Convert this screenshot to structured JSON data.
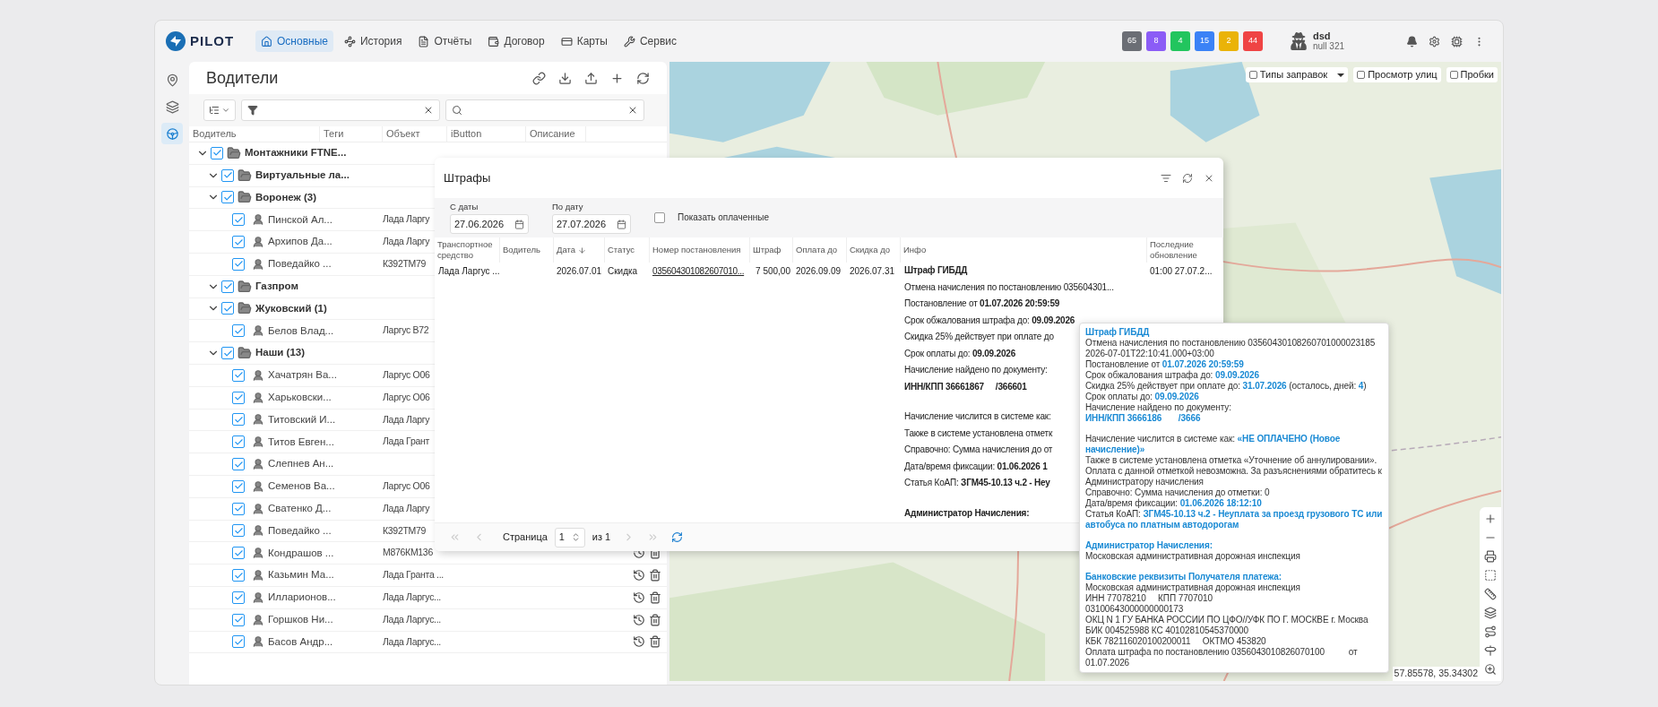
{
  "app": {
    "logo": "PILOT",
    "nav": [
      {
        "label": "Основные",
        "selected": true
      },
      {
        "label": "История",
        "selected": false
      },
      {
        "label": "Отчёты",
        "selected": false
      },
      {
        "label": "Договор",
        "selected": false
      },
      {
        "label": "Карты",
        "selected": false
      },
      {
        "label": "Сервис",
        "selected": false
      }
    ],
    "badges": [
      {
        "text": "65",
        "color": "#6b6e75"
      },
      {
        "text": "8",
        "color": "#8b5cf6"
      },
      {
        "text": "4",
        "color": "#22c55e"
      },
      {
        "text": "15",
        "color": "#3b82f6"
      },
      {
        "text": "2",
        "color": "#eab308"
      },
      {
        "text": "44",
        "color": "#ef4444"
      }
    ],
    "user": {
      "name": "dsd",
      "subtitle": "null 321"
    }
  },
  "sidebar": {
    "items": [
      {
        "selected": false
      },
      {
        "selected": false
      },
      {
        "selected": true
      }
    ]
  },
  "drivers_panel": {
    "title": "Водители",
    "columns": [
      "Водитель",
      "Теги",
      "Объект",
      "iButton",
      "Описание"
    ],
    "tree": [
      {
        "kind": "group",
        "label": "Монтажники FTNE...",
        "expanded": true,
        "checked": true,
        "children": [
          {
            "kind": "group",
            "label": "Виртуальные ла...",
            "expanded": true,
            "checked": true
          },
          {
            "kind": "group",
            "label": "Воронеж (3)",
            "expanded": true,
            "checked": true,
            "children": [
              {
                "kind": "driver",
                "label": "Пинской Ал...",
                "object": "Лада Ларгу",
                "checked": true,
                "actions": false
              },
              {
                "kind": "driver",
                "label": "Архипов Да...",
                "object": "Лада Ларгу",
                "checked": true,
                "actions": false
              },
              {
                "kind": "driver",
                "label": "Поведайко ...",
                "object": "К392ТМ79",
                "checked": true,
                "actions": false
              }
            ]
          },
          {
            "kind": "group",
            "label": "Газпром",
            "expanded": true,
            "checked": true
          },
          {
            "kind": "group",
            "label": "Жуковский (1)",
            "expanded": true,
            "checked": true,
            "children": [
              {
                "kind": "driver",
                "label": "Белов Влад...",
                "object": "Ларгус В72",
                "checked": true,
                "actions": false
              }
            ]
          },
          {
            "kind": "group",
            "label": "Наши (13)",
            "expanded": true,
            "checked": true,
            "children": [
              {
                "kind": "driver",
                "label": "Хачатрян Ва...",
                "object": "Ларгус О06",
                "checked": true,
                "actions": false
              },
              {
                "kind": "driver",
                "label": "Харьковски...",
                "object": "Ларгус О06",
                "checked": true,
                "actions": false
              },
              {
                "kind": "driver",
                "label": "Титовский И...",
                "object": "Лада Ларгу",
                "checked": true,
                "actions": false
              },
              {
                "kind": "driver",
                "label": "Титов Евген...",
                "object": "Лада Грант",
                "checked": true,
                "actions": false
              },
              {
                "kind": "driver",
                "label": "Слепнев Ан...",
                "checked": true,
                "actions": false
              },
              {
                "kind": "driver",
                "label": "Семенов Ва...",
                "object": "Ларгус О06",
                "checked": true,
                "actions": false
              },
              {
                "kind": "driver",
                "label": "Сватенко Д...",
                "object": "Лада Ларгу",
                "checked": true,
                "actions": false
              },
              {
                "kind": "driver",
                "label": "Поведайко ...",
                "object": "К392ТМ79",
                "checked": true,
                "actions": false
              },
              {
                "kind": "driver",
                "label": "Кондрашов ...",
                "object": "М876КМ136",
                "checked": true,
                "actions": true
              },
              {
                "kind": "driver",
                "label": "Казьмин Ма...",
                "object": "Лада Гранта ...",
                "checked": true,
                "actions": true
              },
              {
                "kind": "driver",
                "label": "Илларионов...",
                "object": "Лада Ларгус...",
                "checked": true,
                "actions": true
              },
              {
                "kind": "driver",
                "label": "Горшков Ни...",
                "object": "Лада Ларгус...",
                "checked": true,
                "actions": true
              },
              {
                "kind": "driver",
                "label": "Басов Андр...",
                "object": "Лада Ларгус...",
                "checked": true,
                "actions": true
              }
            ]
          }
        ]
      }
    ]
  },
  "map": {
    "toggles": [
      {
        "label": "Типы заправок",
        "checked": false,
        "dropdown": true
      },
      {
        "label": "Просмотр улиц",
        "checked": false,
        "dropdown": false
      },
      {
        "label": "Пробки",
        "checked": false,
        "dropdown": false
      }
    ],
    "coordinates": "57.85578, 35.34302"
  },
  "fines_dialog": {
    "title": "Штрафы",
    "from": {
      "label": "С даты",
      "value": "27.06.2026"
    },
    "to": {
      "label": "По дату",
      "value": "27.07.2026"
    },
    "show_paid": {
      "label": "Показать оплаченные",
      "checked": false
    },
    "columns": [
      "Транспортное средство",
      "Водитель",
      "Дата",
      "Статус",
      "Номер постановления",
      "Штраф",
      "Оплата до",
      "Скидка до",
      "Инфо",
      "Последние обновление"
    ],
    "rows": [
      {
        "vehicle": "Лада Ларгус ...",
        "date": "2026.07.01",
        "status": "Скидка",
        "number": "035604301082607010...",
        "fine": "7 500,00",
        "pay_until": "2026.09.09",
        "discount_until": "2026.07.31",
        "updated": "01:00 27.07.2...",
        "info": [
          {
            "text": "Штраф ГИБДД",
            "kind": "bold",
            "gap": false
          },
          {
            "text": "Отмена начисления по постановлению 035604301...",
            "kind": "text",
            "gap": false
          },
          {
            "text": "Постановление от **01.07.2026 20:59:59**",
            "kind": "text",
            "gap": false
          },
          {
            "text": "Срок обжалования штрафа до: **09.09.2026**",
            "kind": "text",
            "gap": false
          },
          {
            "text": "Скидка 25% действует при оплате до",
            "kind": "text",
            "gap": false
          },
          {
            "text": "Срок оплаты до: **09.09.2026**",
            "kind": "text",
            "gap": false
          },
          {
            "text": "Начисление найдено по документу:",
            "kind": "text",
            "gap": false
          },
          {
            "text": "ИНН/КПП 36661867     /366601",
            "kind": "bold",
            "gap": false
          },
          {
            "text": "Начисление числится в системе как:",
            "kind": "text",
            "gap": true
          },
          {
            "text": "Также в системе установлена отметк",
            "kind": "text",
            "gap": false
          },
          {
            "text": "Справочно: Сумма начисления до от",
            "kind": "text",
            "gap": false
          },
          {
            "text": "Дата/время фиксации: **01.06.2026 1**",
            "kind": "text",
            "gap": false
          },
          {
            "text": "Статья КоАП: **ЗГМ45-10.13 ч.2 - Неу**",
            "kind": "text",
            "gap": false
          },
          {
            "text": "Администратор Начисления:",
            "kind": "bold",
            "gap": true
          }
        ]
      }
    ],
    "pager": {
      "label": "Страница",
      "page": "1",
      "of": "из 1"
    }
  },
  "tooltip": {
    "lines": [
      {
        "text": "Штраф ГИБДД",
        "kind": "heading",
        "gap": false
      },
      {
        "text": "Отмена начисления по постановлению 03560430108260701000023185 2026-07-01T22:10:41.000+03:00",
        "kind": "text",
        "gap": false
      },
      {
        "text": "Постановление от **01.07.2026 20:59:59**",
        "kind": "text",
        "gap": false
      },
      {
        "text": "Срок обжалования штрафа до: **09.09.2026**",
        "kind": "text",
        "gap": false
      },
      {
        "text": "Скидка 25% действует при оплате до: **31.07.2026** (осталось, дней: **4**)",
        "kind": "text",
        "gap": false
      },
      {
        "text": "Срок оплаты до: **09.09.2026**",
        "kind": "text",
        "gap": false
      },
      {
        "text": "Начисление найдено по документу:",
        "kind": "text",
        "gap": false
      },
      {
        "text": "ИНН/КПП 3666186       /3666",
        "kind": "heading",
        "gap": false
      },
      {
        "text": "Начисление числится в системе как: **«НЕ ОПЛАЧЕНО (Новое начисление)»**",
        "kind": "text",
        "gap": true
      },
      {
        "text": "Также в системе установлена отметка «Уточнение об аннулировании». Оплата с данной отметкой невозможна. За разъяснениями обратитесь к Администратору начисления",
        "kind": "text",
        "gap": false
      },
      {
        "text": "Справочно: Сумма начисления до отметки: 0",
        "kind": "text",
        "gap": false
      },
      {
        "text": "Дата/время фиксации: **01.06.2026 18:12:10**",
        "kind": "text",
        "gap": false
      },
      {
        "text": "Статья КоАП: **ЗГМ45-10.13 ч.2 - Неуплата за проезд грузового ТС или автобуса по платным автодорогам**",
        "kind": "text",
        "gap": false
      },
      {
        "text": "Администратор Начисления:",
        "kind": "heading",
        "gap": true
      },
      {
        "text": "Московская административная дорожная инспекция",
        "kind": "text",
        "gap": false
      },
      {
        "text": "Банковские реквизиты Получателя платежа:",
        "kind": "heading",
        "gap": true
      },
      {
        "text": "Московская административная дорожная инспекция",
        "kind": "text",
        "gap": false
      },
      {
        "text": "ИНН 77078210     КПП 7707010",
        "kind": "text",
        "gap": false
      },
      {
        "text": "03100643000000000173",
        "kind": "text",
        "gap": false
      },
      {
        "text": "ОКЦ N 1 ГУ БАНКА РОССИИ ПО ЦФО//УФК ПО Г. МОСКВЕ г. Москва",
        "kind": "text",
        "gap": false
      },
      {
        "text": "БИК 004525988 КС 40102810545370000",
        "kind": "text",
        "gap": false
      },
      {
        "text": "КБК 782116020100200011     ОКТМО 453820",
        "kind": "text",
        "gap": false
      },
      {
        "text": "Оплата штрафа по постановлению 0356043010826070100          от 01.07.2026",
        "kind": "text",
        "gap": false
      }
    ]
  }
}
